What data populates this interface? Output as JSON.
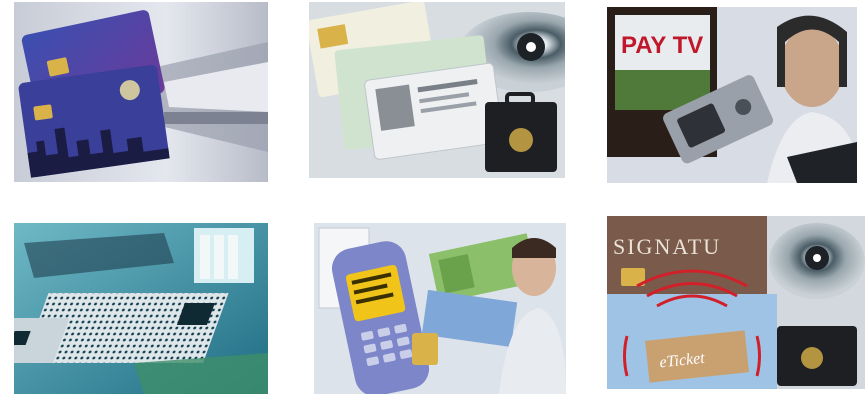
{
  "tiles": [
    {
      "id": "transit-card"
    },
    {
      "id": "id-documents"
    },
    {
      "id": "pay-tv",
      "sign_text": "PAY TV"
    },
    {
      "id": "rfid-logistics"
    },
    {
      "id": "mobile-payment"
    },
    {
      "id": "esignature-eticket",
      "signature_text": "SIGNATU",
      "eticket_text": "eTicket"
    }
  ]
}
